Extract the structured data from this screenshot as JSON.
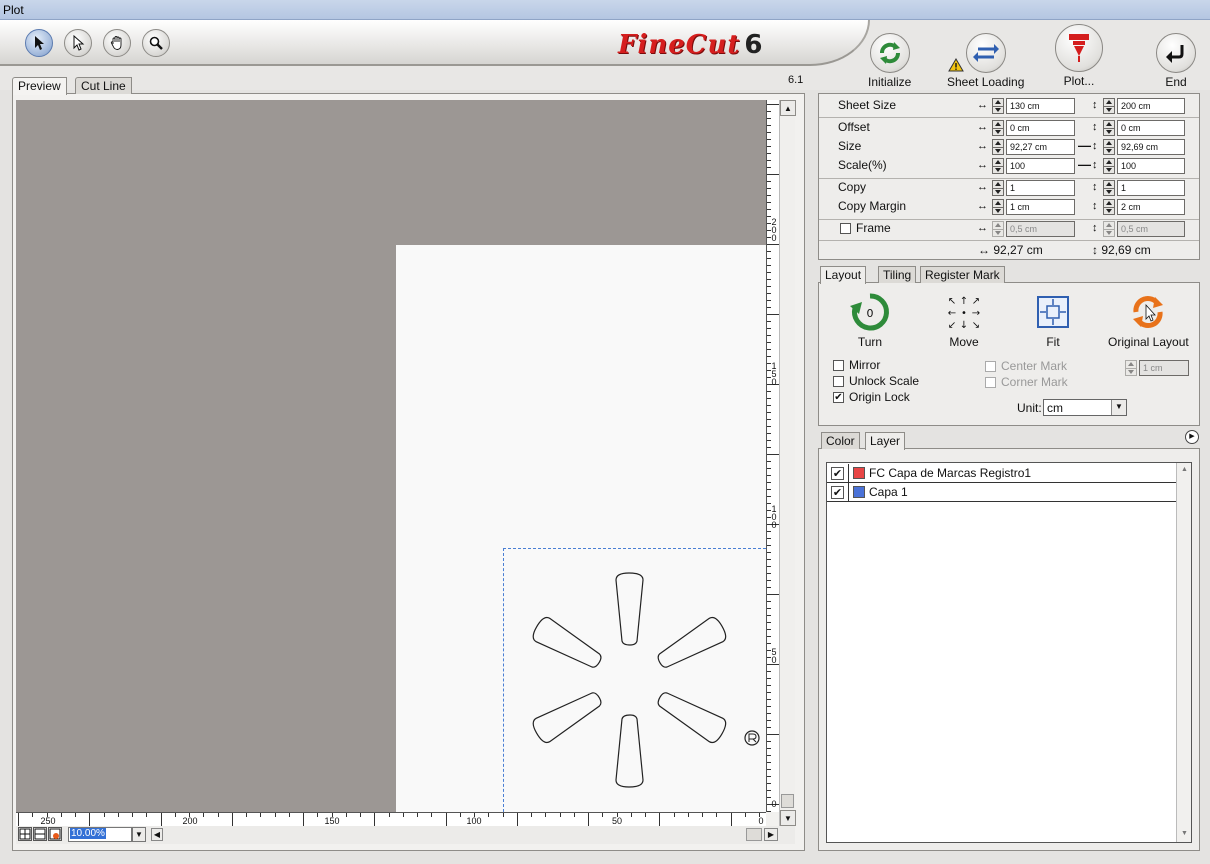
{
  "window": {
    "title": "Plot"
  },
  "toolbar": {
    "tools": [
      "select-arrow",
      "direct-select-arrow",
      "hand",
      "zoom"
    ],
    "logo_text": "FineCut",
    "logo_version": "6",
    "version_label": "6.1",
    "buttons": {
      "initialize": "Initialize",
      "sheet_loading": "Sheet Loading",
      "plot": "Plot...",
      "end": "End"
    }
  },
  "preview_tabs": {
    "preview": "Preview",
    "cut_line": "Cut Line"
  },
  "ruler": {
    "vertical": [
      "2\n0\n0",
      "1\n5\n0",
      "1\n0\n0",
      "5\n0",
      "0"
    ],
    "horizontal": [
      "250",
      "200",
      "150",
      "100",
      "50",
      "0"
    ]
  },
  "zoom": {
    "value": "10.00%"
  },
  "settings": {
    "sheet_size": {
      "label": "Sheet Size",
      "width": "130 cm",
      "height": "200 cm"
    },
    "offset": {
      "label": "Offset",
      "x": "0 cm",
      "y": "0 cm"
    },
    "size": {
      "label": "Size",
      "width": "92,27 cm",
      "height": "92,69 cm"
    },
    "scale": {
      "label": "Scale(%)",
      "x": "100",
      "y": "100"
    },
    "copy": {
      "label": "Copy",
      "x": "1",
      "y": "1"
    },
    "copy_margin": {
      "label": "Copy Margin",
      "x": "1 cm",
      "y": "2 cm"
    },
    "frame": {
      "label": "Frame",
      "x": "0,5 cm",
      "y": "0,5 cm"
    },
    "total_width": "92,27 cm",
    "total_height": "92,69 cm"
  },
  "layout_tabs": {
    "layout": "Layout",
    "tiling": "Tiling",
    "register_mark": "Register Mark"
  },
  "layout": {
    "turn": "Turn",
    "turn_count": "0",
    "move": "Move",
    "fit": "Fit",
    "original_layout": "Original Layout",
    "mirror": "Mirror",
    "unlock_scale": "Unlock Scale",
    "origin_lock": "Origin Lock",
    "origin_lock_checked": "✔",
    "center_mark": "Center Mark",
    "corner_mark": "Corner Mark",
    "mark_margin": "1 cm",
    "unit_label": "Unit:",
    "unit_value": "cm"
  },
  "layer_tabs": {
    "color": "Color",
    "layer": "Layer"
  },
  "layers": [
    {
      "check": "✔",
      "color": "#e84545",
      "name": "FC Capa de Marcas Registro1"
    },
    {
      "check": "✔",
      "color": "#4a72d8",
      "name": "Capa 1"
    }
  ],
  "colors": {
    "accent_red": "#d61e1e",
    "selection_blue": "#3370d6",
    "canvas_gray": "#9c9794"
  }
}
